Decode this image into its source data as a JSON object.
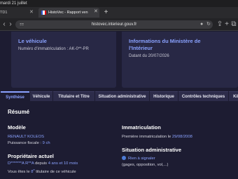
{
  "status_bar": {
    "time": "mardi 21 juillet"
  },
  "browser": {
    "tabs": [
      {
        "label": "TD1",
        "active": false
      },
      {
        "label": "HistoVec - Rapport ven",
        "active": true
      }
    ],
    "url": "histovec.interieur.gouv.fr",
    "icons": [
      "back-icon",
      "forward-icon",
      "lock-icon",
      "mic-icon",
      "share-icon",
      "add-icon",
      "tabs-icon"
    ]
  },
  "cards": [
    {
      "title": "Le véhicule",
      "lines": [
        "Numéro d'immatriculation : AK-0**-PR"
      ]
    },
    {
      "title_line1": "Informations du Ministère de",
      "title_line2": "l'Intérieur",
      "lines": [
        "Datant du 20/07/2026"
      ]
    }
  ],
  "page_tabs": [
    "Synthèse",
    "Véhicule",
    "Titulaire et Titre",
    "Situation administrative",
    "Historique",
    "Contrôles techniques",
    "Kil"
  ],
  "summary": {
    "heading": "Résumé",
    "modele": {
      "heading": "Modèle",
      "vehicle": "RENAULT KOLEOS",
      "power_label": "Puissance fiscale : ",
      "power_value": "9 ch"
    },
    "immatriculation": {
      "heading": "Immatriculation",
      "first_label": "Première immatriculation le ",
      "first_date": "29/08/2008"
    },
    "proprietaire": {
      "heading": "Propriétaire actuel",
      "name": "D*******A R**A",
      "since_label": " depuis ",
      "since_value": "4 ans et 10 mois",
      "rank_prefix": "Vous êtes le ",
      "rank_value": "8",
      "rank_sup": "e",
      "rank_suffix": " titulaire de ce véhicule"
    },
    "situation": {
      "heading": "Situation administrative",
      "status": "Rien à signaler",
      "note": "(gages, opposition, vol,...)"
    }
  }
}
